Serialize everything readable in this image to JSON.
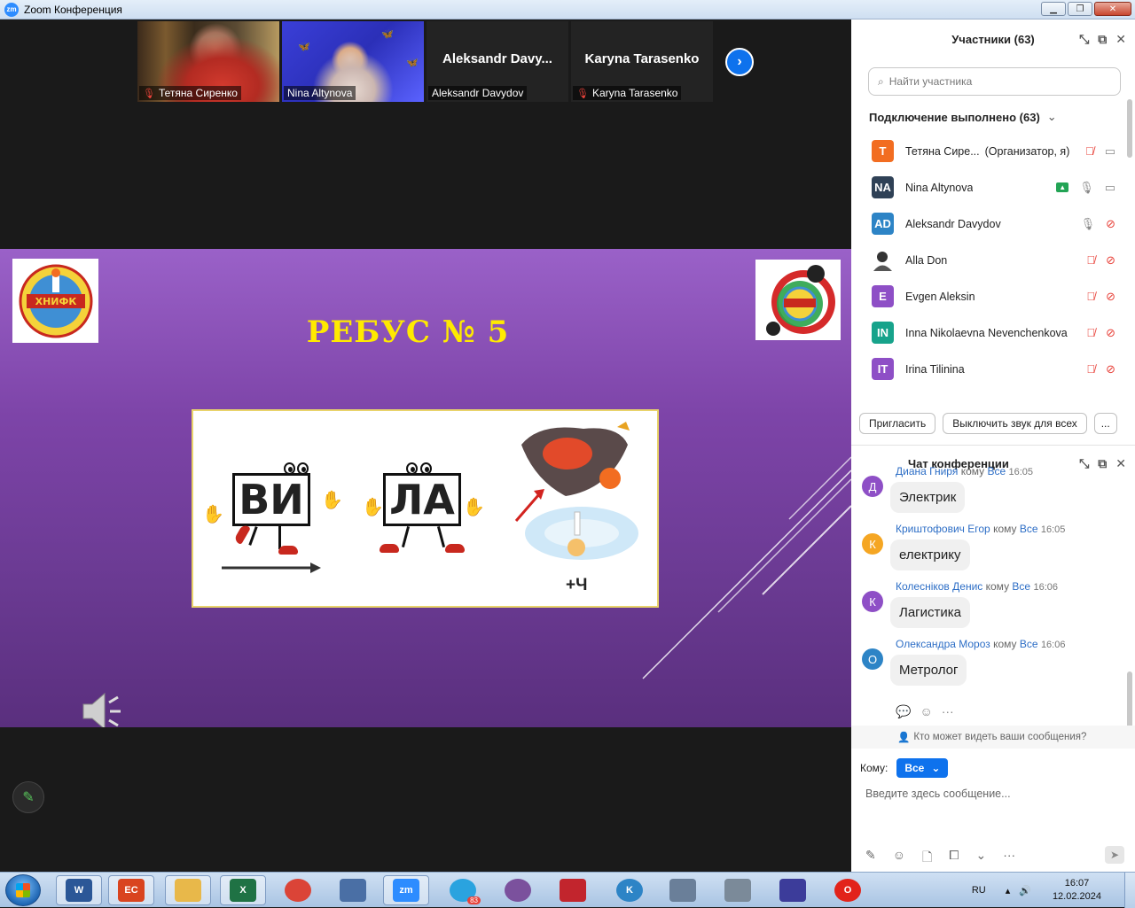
{
  "window": {
    "title": "Zoom Конференция",
    "logo": "zm"
  },
  "video_strip": [
    {
      "name": "Тетяна Сиренко",
      "muted": true,
      "has_video": true,
      "big_name": ""
    },
    {
      "name": "Nina Altynova",
      "muted": false,
      "has_video": true,
      "big_name": "",
      "active": true
    },
    {
      "name": "Aleksandr Davydov",
      "muted": false,
      "has_video": false,
      "big_name": "Aleksandr  Davy..."
    },
    {
      "name": "Karyna Tarasenko",
      "muted": true,
      "has_video": false,
      "big_name": "Karyna Tarasenko"
    }
  ],
  "slide": {
    "title": "РЕБУС № 5",
    "word1": "ВИ",
    "word2": "ЛА",
    "suffix": "+Ч",
    "logo_left_text": "ХНИФК"
  },
  "participants": {
    "header": "Участники (63)",
    "search_placeholder": "Найти участника",
    "group_label": "Подключение выполнено (63)",
    "items": [
      {
        "initials": "Т",
        "name": "Тетяна Сире...",
        "role": "(Организатор, я)",
        "color": "#f26d21",
        "mic": "off",
        "video": "on",
        "share": false
      },
      {
        "initials": "NA",
        "name": "Nina Altynova",
        "role": "",
        "color": "#2f4156",
        "mic": "on",
        "video": "on",
        "share": true
      },
      {
        "initials": "AD",
        "name": "Aleksandr Davydov",
        "role": "",
        "color": "#2d84c6",
        "mic": "on",
        "video": "off",
        "share": false
      },
      {
        "initials": "",
        "name": "Alla Don",
        "role": "",
        "color": "#ffffff",
        "mic": "off",
        "video": "off",
        "share": false,
        "photo": true
      },
      {
        "initials": "E",
        "name": "Evgen Aleksin",
        "role": "",
        "color": "#8e4fc6",
        "mic": "off",
        "video": "off",
        "share": false
      },
      {
        "initials": "IN",
        "name": "Inna Nikolaevna Nevenchenkova",
        "role": "",
        "color": "#17a38b",
        "mic": "off",
        "video": "off",
        "share": false
      },
      {
        "initials": "IT",
        "name": "Irina Tilinina",
        "role": "",
        "color": "#8e4fc6",
        "mic": "off",
        "video": "off",
        "share": false
      }
    ],
    "invite_label": "Пригласить",
    "mute_all_label": "Выключить звук для всех",
    "more_label": "..."
  },
  "chat": {
    "header": "Чат конференции",
    "messages": [
      {
        "initial": "Д",
        "color": "#8e4fc6",
        "sender": "Диана Гниря",
        "to_word": "кому",
        "to": "Все",
        "time": "16:05",
        "text": "Электрик"
      },
      {
        "initial": "К",
        "color": "#f5a623",
        "sender": "Криштофович Егор",
        "to_word": "кому",
        "to": "Все",
        "time": "16:05",
        "text": "електрику"
      },
      {
        "initial": "К",
        "color": "#8e4fc6",
        "sender": "Колеснiков Денис",
        "to_word": "кому",
        "to": "Все",
        "time": "16:06",
        "text": "Лагистика"
      },
      {
        "initial": "О",
        "color": "#2d84c6",
        "sender": "Олександра Мороз",
        "to_word": "кому",
        "to": "Все",
        "time": "16:06",
        "text": "Метролог"
      }
    ],
    "who_can_see": "Кто может видеть ваши сообщения?",
    "to_label": "Кому:",
    "to_value": "Все",
    "input_placeholder": "Введите здесь сообщение..."
  },
  "taskbar": {
    "apps": [
      {
        "id": "word",
        "label": "W",
        "color": "#2b5797"
      },
      {
        "id": "ec",
        "label": "EC",
        "color": "#d9441f"
      },
      {
        "id": "explorer",
        "label": "",
        "color": "#e8b84a"
      },
      {
        "id": "excel",
        "label": "X",
        "color": "#1f7244"
      },
      {
        "id": "chrome",
        "label": "",
        "color": "#db4437"
      },
      {
        "id": "drawing",
        "label": "",
        "color": "#4a6fa5"
      },
      {
        "id": "zoom",
        "label": "zm",
        "color": "#2d8cff"
      },
      {
        "id": "telegram",
        "label": "",
        "color": "#2aa3df",
        "badge": "83"
      },
      {
        "id": "viber",
        "label": "",
        "color": "#7b519d"
      },
      {
        "id": "app-red",
        "label": "",
        "color": "#c2252d"
      },
      {
        "id": "app-k",
        "label": "K",
        "color": "#2d84c6"
      },
      {
        "id": "calculator",
        "label": "",
        "color": "#6a7f99"
      },
      {
        "id": "scanner",
        "label": "",
        "color": "#7b8a99"
      },
      {
        "id": "pen",
        "label": "",
        "color": "#3c3c9a"
      },
      {
        "id": "opera",
        "label": "O",
        "color": "#e2231a"
      }
    ],
    "lang": "RU",
    "time": "16:07",
    "date": "12.02.2024"
  }
}
